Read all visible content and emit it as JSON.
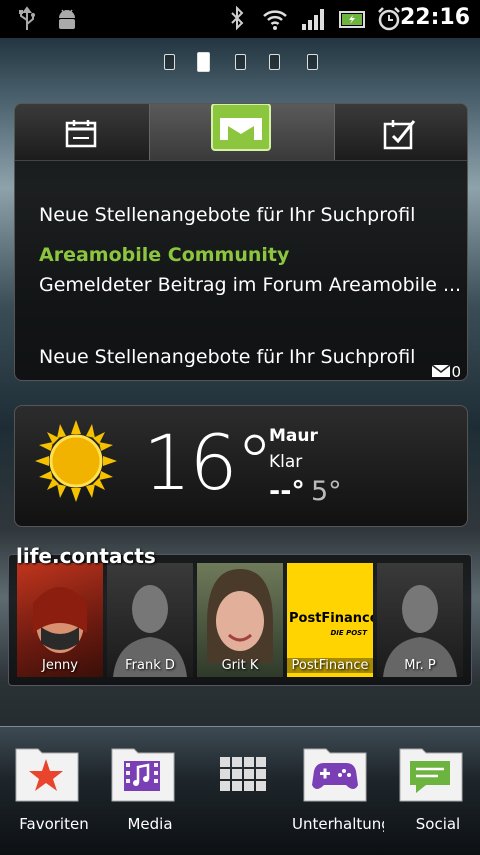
{
  "status_bar": {
    "icons": [
      "usb-icon",
      "android-debug-icon",
      "bluetooth-icon",
      "wifi-icon",
      "signal-icon",
      "battery-icon",
      "alarm-icon"
    ],
    "time": "22:16"
  },
  "pager": {
    "pages": 5,
    "active": 2
  },
  "messaging": {
    "tabs": [
      "calendar-icon",
      "mail-icon",
      "tasks-icon"
    ],
    "messages": [
      {
        "text": "Neue Stellenangebote für Ihr Suchprofil"
      },
      {
        "sender": "Areamobile Community",
        "text": "Gemeldeter Beitrag im Forum Areamobile ..."
      },
      {
        "text": "Neue Stellenangebote für Ihr Suchprofil"
      }
    ],
    "unread_count": "0"
  },
  "weather": {
    "icon": "sun-icon",
    "temperature": "16°",
    "city": "Maur",
    "condition": "Klar",
    "low": "--°",
    "high": "5°"
  },
  "contacts": {
    "title": "life.contacts",
    "items": [
      {
        "name": "Jenny"
      },
      {
        "name": "Frank D"
      },
      {
        "name": "Grit K"
      },
      {
        "name": "PostFinance",
        "logo_text": "PostFinance",
        "logo_sub": "DIE POST"
      },
      {
        "name": "Mr. P"
      }
    ]
  },
  "dock": {
    "items": [
      {
        "label": "Favoriten",
        "icon": "star-icon"
      },
      {
        "label": "Media",
        "icon": "film-icon"
      },
      {
        "label": "",
        "icon": "app-grid-icon"
      },
      {
        "label": "Unterhaltung",
        "icon": "gamepad-icon"
      },
      {
        "label": "Social",
        "icon": "chat-icon"
      }
    ]
  },
  "colors": {
    "accent_green": "#8cc63f",
    "sun": "#f6c200",
    "postfinance_yellow": "#ffd400"
  }
}
